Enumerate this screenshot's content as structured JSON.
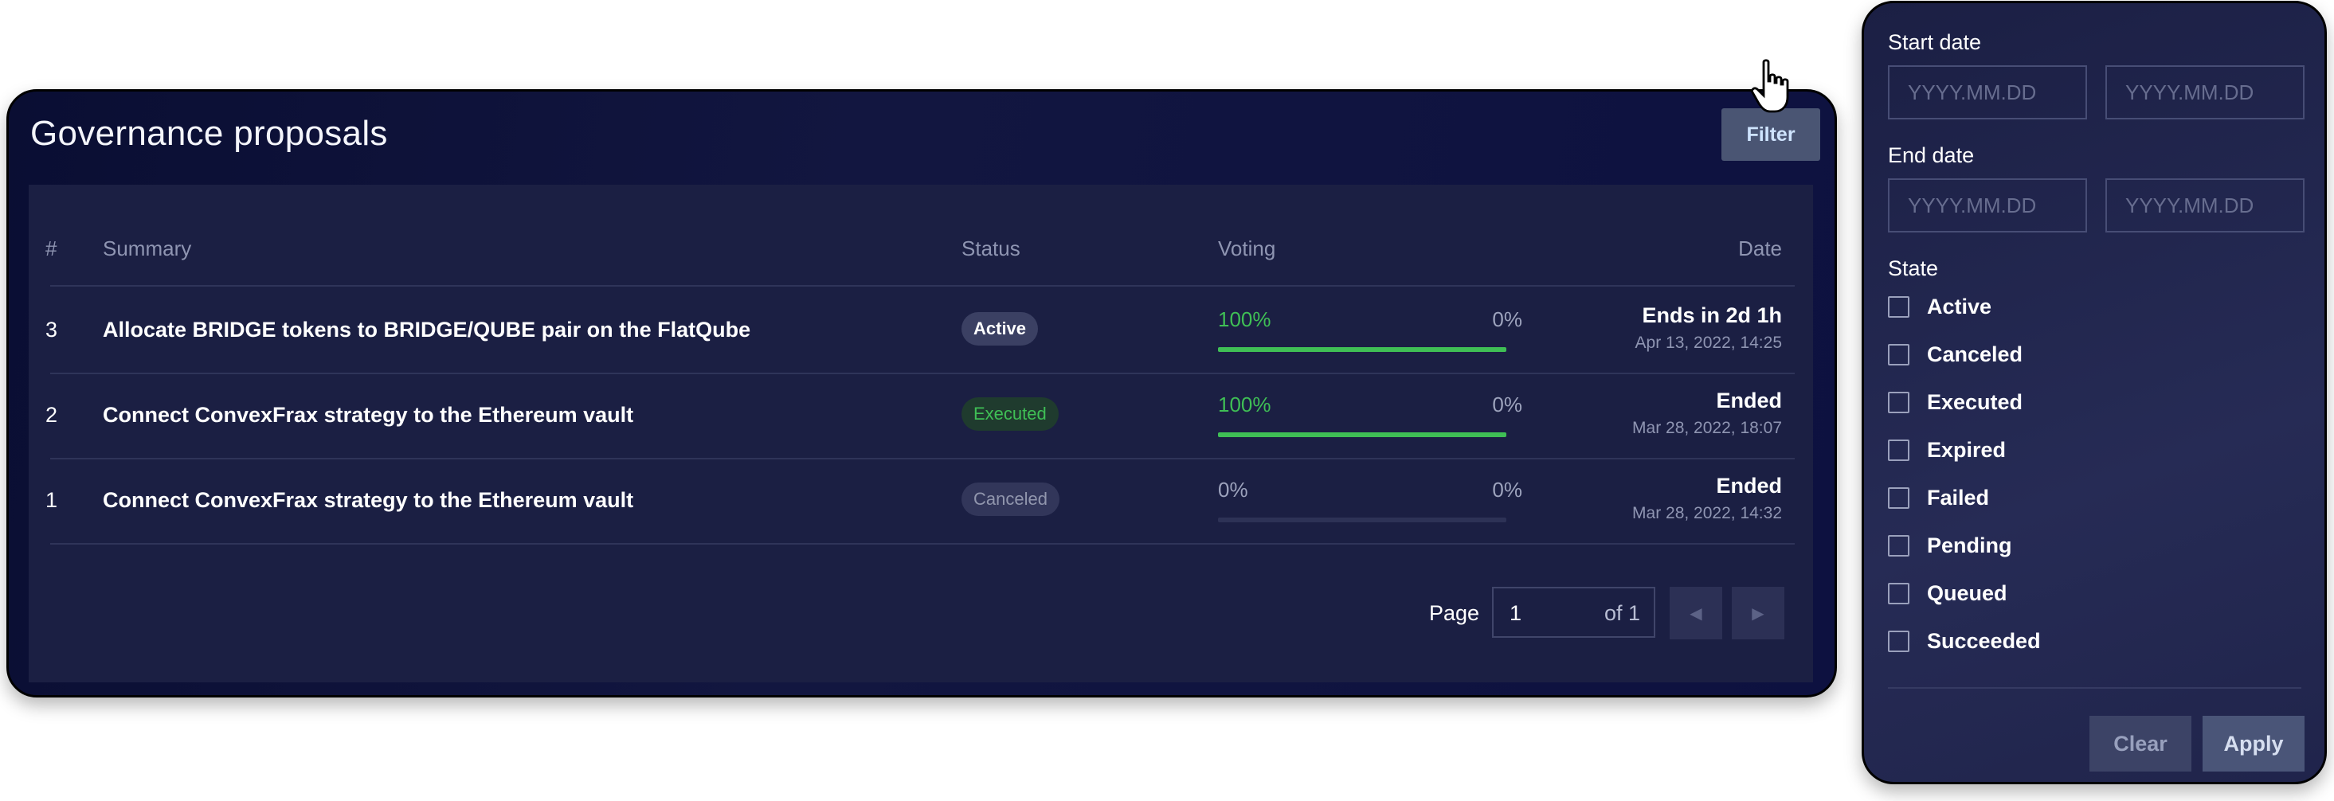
{
  "card": {
    "title": "Governance proposals",
    "filter_label": "Filter"
  },
  "table": {
    "headers": {
      "num": "#",
      "summary": "Summary",
      "status": "Status",
      "voting": "Voting",
      "date": "Date"
    },
    "rows": [
      {
        "num": "3",
        "summary": "Allocate BRIDGE tokens to BRIDGE/QUBE pair on the FlatQube",
        "status": "Active",
        "status_kind": "active",
        "yes": "100%",
        "no": "0%",
        "yes_fraction": 1.0,
        "date_main": "Ends in 2d 1h",
        "date_sub": "Apr 13, 2022, 14:25"
      },
      {
        "num": "2",
        "summary": "Connect ConvexFrax strategy to the Ethereum vault",
        "status": "Executed",
        "status_kind": "executed",
        "yes": "100%",
        "no": "0%",
        "yes_fraction": 1.0,
        "date_main": "Ended",
        "date_sub": "Mar 28, 2022, 18:07"
      },
      {
        "num": "1",
        "summary": "Connect ConvexFrax strategy to the Ethereum vault",
        "status": "Canceled",
        "status_kind": "canceled",
        "yes": "0%",
        "no": "0%",
        "yes_fraction": 0.0,
        "date_main": "Ended",
        "date_sub": "Mar 28, 2022, 14:32"
      }
    ]
  },
  "pagination": {
    "label": "Page",
    "current": "1",
    "of_label": "of 1",
    "prev_icon": "chevron-left-icon",
    "next_icon": "chevron-right-icon"
  },
  "filter_panel": {
    "start_date_label": "Start date",
    "end_date_label": "End date",
    "date_placeholder": "YYYY.MM.DD",
    "state_label": "State",
    "states": [
      "Active",
      "Canceled",
      "Executed",
      "Expired",
      "Failed",
      "Pending",
      "Queued",
      "Succeeded"
    ],
    "clear_label": "Clear",
    "apply_label": "Apply"
  },
  "colors": {
    "accent_green": "#3fbf55",
    "card_bg": "#121640",
    "panel_bg": "#262b55"
  }
}
